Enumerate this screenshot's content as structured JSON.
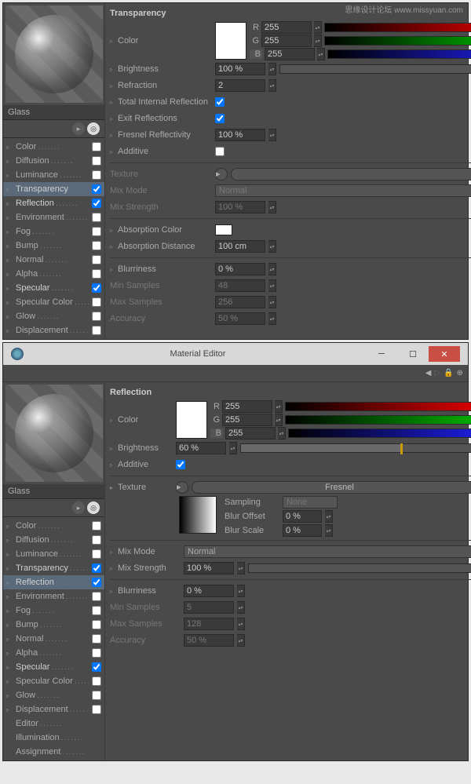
{
  "watermark": "思缘设计论坛 www.missyuan.com",
  "material_name": "Glass",
  "window_title": "Material Editor",
  "channels": [
    {
      "label": "Color",
      "checked": false
    },
    {
      "label": "Diffusion",
      "checked": false
    },
    {
      "label": "Luminance",
      "checked": false
    },
    {
      "label": "Transparency",
      "checked": true
    },
    {
      "label": "Reflection",
      "checked": true
    },
    {
      "label": "Environment",
      "checked": false
    },
    {
      "label": "Fog",
      "checked": false
    },
    {
      "label": "Bump",
      "checked": false
    },
    {
      "label": "Normal",
      "checked": false
    },
    {
      "label": "Alpha",
      "checked": false
    },
    {
      "label": "Specular",
      "checked": true
    },
    {
      "label": "Specular Color",
      "checked": false
    },
    {
      "label": "Glow",
      "checked": false
    },
    {
      "label": "Displacement",
      "checked": false
    }
  ],
  "extra_channels": [
    "Editor",
    "Illumination",
    "Assignment"
  ],
  "transparency": {
    "title": "Transparency",
    "color_label": "Color",
    "r_label": "R",
    "r_val": "255",
    "g_label": "G",
    "g_val": "255",
    "b_label": "B",
    "b_val": "255",
    "brightness_label": "Brightness",
    "brightness_val": "100 %",
    "refraction_label": "Refraction",
    "refraction_val": "2",
    "tir_label": "Total Internal Reflection",
    "exit_label": "Exit Reflections",
    "fresnel_label": "Fresnel Reflectivity",
    "fresnel_val": "100 %",
    "additive_label": "Additive",
    "texture_label": "Texture",
    "mixmode_label": "Mix Mode",
    "mixmode_val": "Normal",
    "mixstrength_label": "Mix Strength",
    "mixstrength_val": "100 %",
    "absorb_color_label": "Absorption Color",
    "absorb_dist_label": "Absorption Distance",
    "absorb_dist_val": "100 cm",
    "blur_label": "Blurriness",
    "blur_val": "0 %",
    "minsamp_label": "Min Samples",
    "minsamp_val": "48",
    "maxsamp_label": "Max Samples",
    "maxsamp_val": "256",
    "accuracy_label": "Accuracy",
    "accuracy_val": "50 %"
  },
  "reflection": {
    "title": "Reflection",
    "color_label": "Color",
    "r_label": "R",
    "r_val": "255",
    "g_label": "G",
    "g_val": "255",
    "b_label": "B",
    "b_val": "255",
    "brightness_label": "Brightness",
    "brightness_val": "60 %",
    "brightness_pct": 60,
    "additive_label": "Additive",
    "texture_label": "Texture",
    "texture_val": "Fresnel",
    "sampling_label": "Sampling",
    "sampling_val": "None",
    "bluroff_label": "Blur Offset",
    "bluroff_val": "0 %",
    "blurscale_label": "Blur Scale",
    "blurscale_val": "0 %",
    "mixmode_label": "Mix Mode",
    "mixmode_val": "Normal",
    "mixstrength_label": "Mix Strength",
    "mixstrength_val": "100 %",
    "blur_label": "Blurriness",
    "blur_val": "0 %",
    "minsamp_label": "Min Samples",
    "minsamp_val": "5",
    "maxsamp_label": "Max Samples",
    "maxsamp_val": "128",
    "accuracy_label": "Accuracy",
    "accuracy_val": "50 %"
  }
}
